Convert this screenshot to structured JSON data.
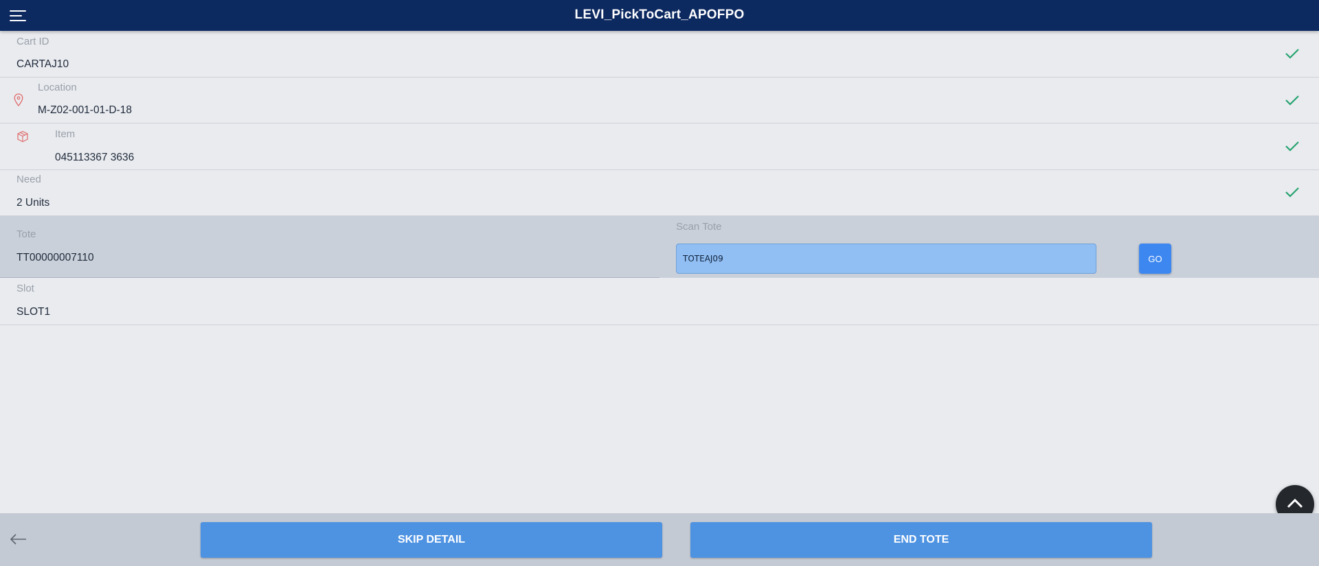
{
  "header": {
    "title": "LEVI_PickToCart_APOFPO",
    "menu_icon": "hamburger-menu-icon"
  },
  "fields": {
    "cart": {
      "label": "Cart ID",
      "value": "CARTAJ10"
    },
    "location": {
      "label": "Location",
      "value": "M-Z02-001-01-D-18",
      "icon": "location-pin-icon"
    },
    "item": {
      "label": "Item",
      "value": "045113367 3636",
      "icon": "package-icon"
    },
    "need": {
      "label": "Need",
      "value": "2 Units"
    },
    "tote": {
      "label": "Tote",
      "value": "TT00000007110"
    },
    "slot": {
      "label": "Slot",
      "value": "SLOT1"
    }
  },
  "scan": {
    "label": "Scan Tote",
    "value": "TOTEAJ09",
    "go_label": "GO"
  },
  "footer": {
    "skip_label": "SKIP DETAIL",
    "end_label": "END TOTE"
  },
  "colors": {
    "header_bg": "#0c2960",
    "check": "#27a36f",
    "icon_red": "#e06a6a",
    "button_blue": "#4e93e2",
    "input_bg": "#91bff3"
  }
}
